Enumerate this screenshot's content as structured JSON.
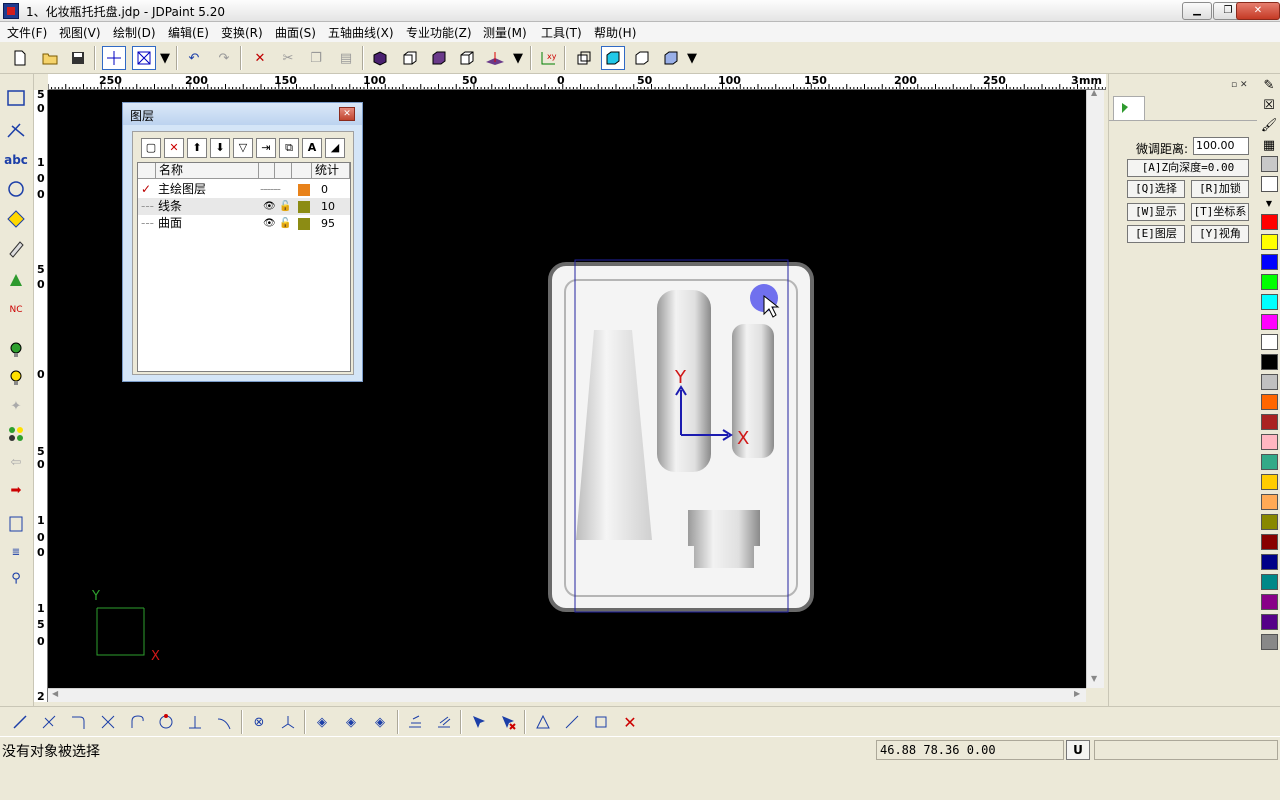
{
  "window": {
    "title": "1、化妆瓶托托盘.jdp - JDPaint 5.20"
  },
  "menu": [
    "文件(F)",
    "视图(V)",
    "绘制(D)",
    "编辑(E)",
    "变换(R)",
    "曲面(S)",
    "五轴曲线(X)",
    "专业功能(Z)",
    "测量(M)",
    "工具(T)",
    "帮助(H)"
  ],
  "ruler": {
    "h_labels": [
      "250",
      "200",
      "150",
      "100",
      "50",
      "0",
      "50",
      "100",
      "150",
      "200",
      "250",
      "3"
    ],
    "h_unit": "mm",
    "v_labels": [
      "5",
      "0",
      "1",
      "0",
      "0",
      "5",
      "0",
      "0",
      "5",
      "0",
      "1",
      "0",
      "0",
      "1",
      "5",
      "0",
      "2"
    ]
  },
  "layer_panel": {
    "title": "图层",
    "columns": {
      "name": "名称",
      "count": "统计"
    },
    "rows": [
      {
        "name": "主绘图层",
        "count": "0",
        "color": "#e8821a",
        "current": true
      },
      {
        "name": "线条",
        "count": "10",
        "color": "#8c8c14",
        "current": false
      },
      {
        "name": "曲面",
        "count": "95",
        "color": "#8c8c14",
        "current": false
      }
    ]
  },
  "axes": {
    "y": "Y",
    "x": "X"
  },
  "right_panel": {
    "fine_label": "微调距离:",
    "fine_value": "100.00",
    "depth_button": "[A]Z向深度=0.00",
    "buttons": [
      "[Q]选择",
      "[R]加锁",
      "[W]显示",
      "[T]坐标系",
      "[E]图层",
      "[Y]视角"
    ]
  },
  "palette": [
    "#ff0000",
    "#ffff00",
    "#0000ff",
    "#00ff00",
    "#00ffff",
    "#ff00ff",
    "#ffffff",
    "#000000",
    "#c0c0c0",
    "#ff6600",
    "#aa2222",
    "#ffb6c1",
    "#33aa88",
    "#ffcc00",
    "#ffaa55",
    "#888800",
    "#880000",
    "#000088",
    "#008888",
    "#880088",
    "#550088",
    "#888888"
  ],
  "status": {
    "message": "没有对象被选择",
    "coords": "46.88 78.36 0.00",
    "unit_button": "U"
  },
  "icons": {
    "toolbar": [
      "new-file-icon",
      "open-folder-icon",
      "save-icon",
      "crosshair-icon",
      "zoom-window-icon",
      "dropdown-icon",
      "undo-icon",
      "redo-icon",
      "delete-icon",
      "cut-icon",
      "copy-icon",
      "paste-icon",
      "shaded-cube-icon",
      "front-view-icon",
      "side-view-icon",
      "iso-view-icon",
      "axes-icon",
      "coord-icon",
      "view-box-icon",
      "render-icon",
      "wireframe-icon",
      "view-more-icon"
    ]
  }
}
